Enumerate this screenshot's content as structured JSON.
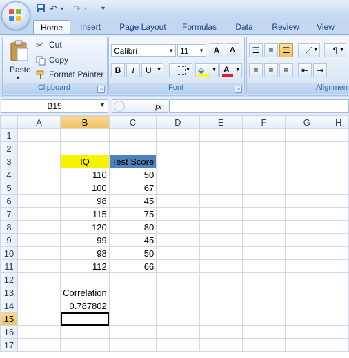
{
  "window": {
    "qat": {
      "save_icon": "save-icon",
      "undo_icon": "undo-icon",
      "redo_icon": "redo-icon",
      "more": "▾"
    }
  },
  "tabs": [
    "Home",
    "Insert",
    "Page Layout",
    "Formulas",
    "Data",
    "Review",
    "View"
  ],
  "ribbon": {
    "clipboard": {
      "paste": "Paste",
      "cut": "Cut",
      "copy": "Copy",
      "format_painter": "Format Painter",
      "label": "Clipboard"
    },
    "font": {
      "family": "Calibri",
      "size": "11",
      "bold": "B",
      "italic": "I",
      "underline": "U",
      "label": "Font",
      "grow": "A",
      "shrink": "A"
    },
    "alignment": {
      "label": "Alignmen"
    }
  },
  "formula_bar": {
    "name_box": "B15",
    "fx": "fx",
    "formula": ""
  },
  "sheet": {
    "columns": [
      "A",
      "B",
      "C",
      "D",
      "E",
      "F",
      "G",
      "H"
    ],
    "rows": [
      "1",
      "2",
      "3",
      "4",
      "5",
      "6",
      "7",
      "8",
      "9",
      "10",
      "11",
      "12",
      "13",
      "14",
      "15",
      "16",
      "17"
    ],
    "headers": {
      "iq": "IQ",
      "test_score": "Test Score"
    },
    "data": [
      {
        "iq": "110",
        "score": "50"
      },
      {
        "iq": "100",
        "score": "67"
      },
      {
        "iq": "98",
        "score": "45"
      },
      {
        "iq": "115",
        "score": "75"
      },
      {
        "iq": "120",
        "score": "80"
      },
      {
        "iq": "99",
        "score": "45"
      },
      {
        "iq": "98",
        "score": "50"
      },
      {
        "iq": "112",
        "score": "66"
      }
    ],
    "correlation_label": "Correlation",
    "correlation_value": "0.787802",
    "active_cell": "B15",
    "colors": {
      "iq_fill": "#f5f300",
      "score_fill": "#4f81bd",
      "selected_header": "#f1c15f"
    }
  }
}
